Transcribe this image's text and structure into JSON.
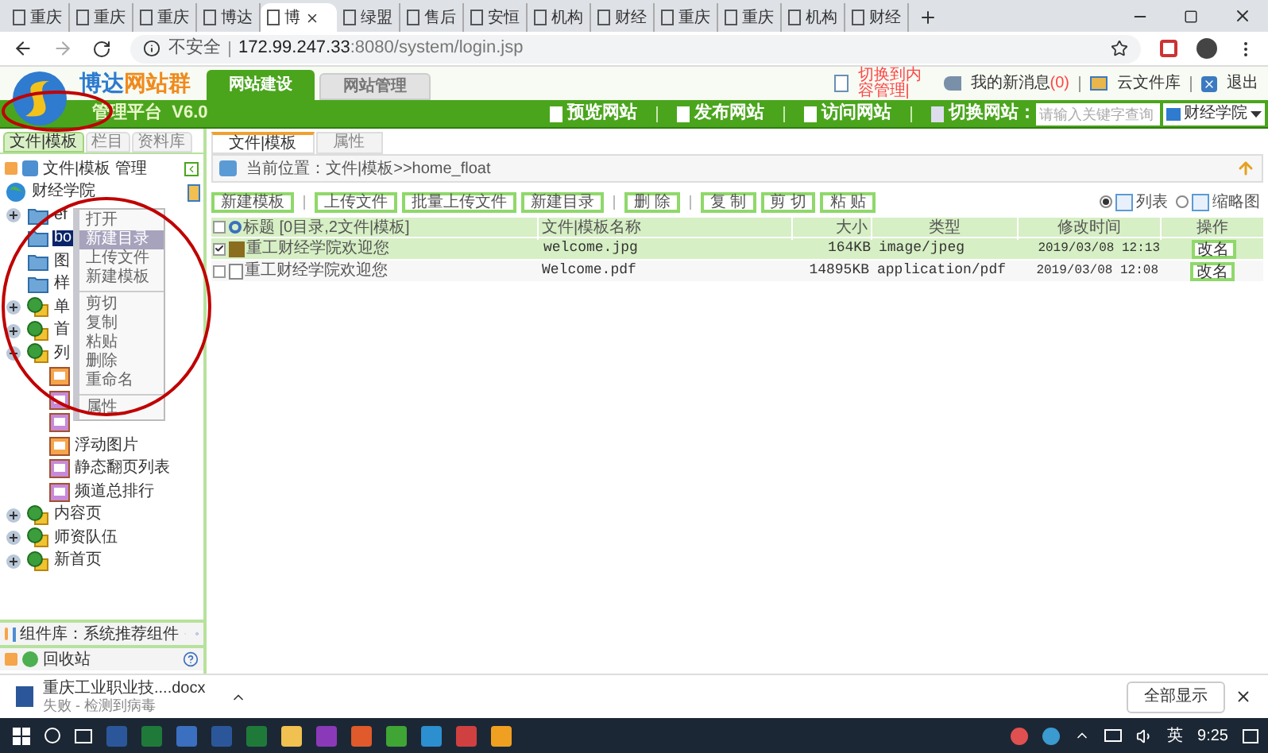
{
  "browser": {
    "tabs": [
      {
        "title": "重庆",
        "selected": false
      },
      {
        "title": "重庆",
        "selected": false
      },
      {
        "title": "重庆",
        "selected": false
      },
      {
        "title": "博达",
        "selected": false
      },
      {
        "title": "博",
        "selected": true
      },
      {
        "title": "绿盟",
        "selected": false
      },
      {
        "title": "售后",
        "selected": false
      },
      {
        "title": "安恒",
        "selected": false
      },
      {
        "title": "机构",
        "selected": false
      },
      {
        "title": "财经",
        "selected": false
      },
      {
        "title": "重庆",
        "selected": false
      },
      {
        "title": "重庆",
        "selected": false
      },
      {
        "title": "机构",
        "selected": false
      },
      {
        "title": "财经",
        "selected": false
      }
    ],
    "security": "不安全",
    "url_host": "172.99.247.33",
    "url_path": ":8080/system/login.jsp"
  },
  "header": {
    "brand_a": "博达",
    "brand_b": "网站群",
    "subtitle": "管理平台  V6.0",
    "tabs": [
      {
        "label": "网站建设",
        "selected": true
      },
      {
        "label": "网站管理",
        "selected": false
      }
    ],
    "switch_link": "切换到内容管理|",
    "messages": "我的新消息",
    "message_count": "(0)",
    "cloud": "云文件库",
    "logout": "退出",
    "actions": [
      "预览网站",
      "发布网站",
      "访问网站"
    ],
    "switch_label": "切换网站：",
    "search": {
      "placeholder": "请输入关键字查询"
    },
    "site": "财经学院"
  },
  "left": {
    "tabs": [
      {
        "label": "文件|模板",
        "selected": true
      },
      {
        "label": "栏目",
        "selected": false
      },
      {
        "label": "资料库",
        "selected": false
      }
    ],
    "title": "文件|模板 管理",
    "tree": {
      "label": "财经学院",
      "children": [
        {
          "label": "ef",
          "kind": "folder",
          "expanded": false,
          "selected": false
        },
        {
          "label": "bo",
          "kind": "folder",
          "selected": true
        },
        {
          "label": "图",
          "kind": "folder",
          "selected": false
        },
        {
          "label": "样",
          "kind": "folder",
          "selected": false
        },
        {
          "label": "单",
          "kind": "channel",
          "expanded": false,
          "selected": false
        },
        {
          "label": "首",
          "kind": "channel",
          "expanded": false,
          "selected": false
        },
        {
          "label": "列",
          "kind": "channel",
          "expanded": true,
          "selected": false,
          "children": [
            {
              "kind": "template"
            },
            {
              "kind": "template2"
            },
            {
              "kind": "template2"
            },
            {
              "label": "浮动图片",
              "kind": "template",
              "selected": false
            },
            {
              "label": "静态翻页列表",
              "kind": "template2",
              "selected": false
            },
            {
              "label": "频道总排行",
              "kind": "template2",
              "selected": false
            }
          ]
        },
        {
          "label": "内容页",
          "kind": "channel",
          "expanded": false,
          "selected": false
        },
        {
          "label": "师资队伍",
          "kind": "channel",
          "expanded": false,
          "selected": false
        },
        {
          "label": "新首页",
          "kind": "channel",
          "expanded": false,
          "selected": false
        }
      ]
    },
    "components": "组件库：系统推荐组件",
    "recycle": "回收站"
  },
  "context_menu": [
    {
      "label": "打开",
      "selected": false
    },
    {
      "label": "新建目录",
      "selected": true
    },
    {
      "label": "上传文件",
      "selected": false
    },
    {
      "label": "新建模板",
      "selected": false
    },
    {
      "kind": "separator"
    },
    {
      "label": "剪切",
      "selected": false
    },
    {
      "label": "复制",
      "selected": false
    },
    {
      "label": "粘贴",
      "selected": false
    },
    {
      "label": "删除",
      "selected": false
    },
    {
      "label": "重命名",
      "selected": false
    },
    {
      "kind": "separator"
    },
    {
      "label": "属性",
      "selected": false
    }
  ],
  "main": {
    "tabs": [
      {
        "label": "文件|模板",
        "selected": true
      },
      {
        "label": "属性",
        "selected": false
      }
    ],
    "location_label": "当前位置：",
    "location": "文件|模板>>home_float",
    "toolbar": [
      {
        "label": "新建模板"
      },
      {
        "kind": "separator"
      },
      {
        "label": "上传文件"
      },
      {
        "label": "批量上传文件"
      },
      {
        "label": "新建目录"
      },
      {
        "kind": "separator"
      },
      {
        "label": "删 除"
      },
      {
        "kind": "separator"
      },
      {
        "label": "复 制"
      },
      {
        "label": "剪 切"
      },
      {
        "label": "粘 贴"
      }
    ],
    "views": [
      {
        "label": "列表",
        "selected": true
      },
      {
        "label": "缩略图",
        "selected": false
      }
    ],
    "table": {
      "select_all_checked": false,
      "columns": [
        "标题 [0目录,2文件|模板]",
        "文件|模板名称",
        "大小",
        "类型",
        "修改时间",
        "操作"
      ],
      "rows": [
        {
          "checked": true,
          "kind": "image",
          "title": "重工财经学院欢迎您",
          "name": "welcome.jpg",
          "size": "164KB",
          "type": "image/jpeg",
          "time": "2019/03/08 12:13",
          "action": "改名"
        },
        {
          "checked": false,
          "kind": "pdf",
          "title": "重工财经学院欢迎您",
          "name": "Welcome.pdf",
          "size": "14895KB",
          "type": "application/pdf",
          "time": "2019/03/08 12:08",
          "action": "改名"
        }
      ]
    }
  },
  "download": {
    "file": "重庆工业职业技....docx",
    "status": "失败 - 检测到病毒",
    "show_all": "全部显示"
  },
  "taskbar": {
    "ime": "英",
    "time": "9:25"
  }
}
